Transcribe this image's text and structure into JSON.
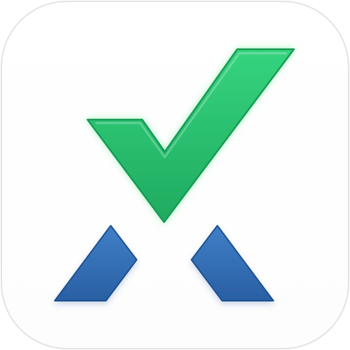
{
  "app_icon": {
    "icon_name": "checkmark-over-x-logo-icon",
    "background_color": "#fdfdfd",
    "border_color": "#e3e3e3",
    "checkmark": {
      "icon_name": "checkmark-icon",
      "fill_top": "#35d47f",
      "fill_bottom": "#1faa60",
      "stroke": "#169a52",
      "glow": "#5ff08f"
    },
    "x_legs": {
      "icon_name": "x-legs-icon",
      "fill_top": "#3f7fc7",
      "fill_bottom": "#2a5fa3",
      "stroke": "#1f4f8f"
    }
  }
}
